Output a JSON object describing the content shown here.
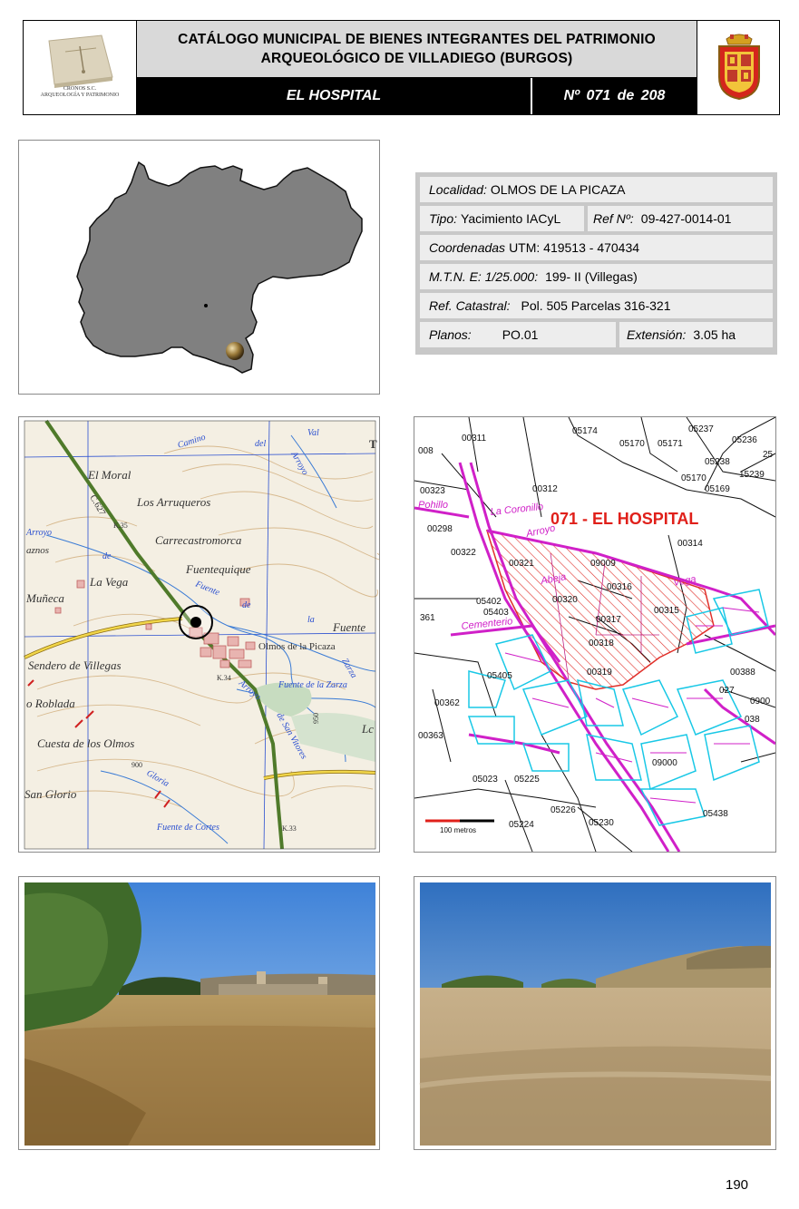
{
  "header": {
    "title": "CATÁLOGO MUNICIPAL DE BIENES INTEGRANTES DEL PATRIMONIO\nARQUEOLÓGICO DE VILLADIEGO (BURGOS)",
    "site_name": "EL HOSPITAL",
    "record_number": "Nº 071 de 208",
    "logo_caption_line1": "CRONOS S.C.",
    "logo_caption_line2": "ARQUEOLOGÍA Y PATRIMONIO"
  },
  "info": {
    "localidad_label": "Localidad:",
    "localidad_value": "OLMOS DE LA PICAZA",
    "tipo_label": "Tipo:",
    "tipo_value": "Yacimiento IACyL",
    "ref_label": "Ref  Nº:",
    "ref_value": "09-427-0014-01",
    "coord_label": "Coordenadas",
    "coord_value": "UTM: 419513 - 470434",
    "mtn_label": "M.T.N. E: 1/25.000:",
    "mtn_value": "199- II (Villegas)",
    "catastral_label": "Ref. Catastral:",
    "catastral_value": "Pol. 505 Parcelas 316-321",
    "planos_label": "Planos:",
    "planos_value": "PO.01",
    "extension_label": "Extensión:",
    "extension_value": "3.05  ha"
  },
  "topo_map": {
    "labels": {
      "el_moral": "El Moral",
      "c627": "C.627",
      "arrueros": "Los Arruqueros",
      "arroyo": "Arroyo",
      "aznos": "aznos",
      "carrecastromorca": "Carrecastromorca",
      "fuentequique": "Fuentequique",
      "la_vega": "La Vega",
      "muneca": "Muñeca",
      "fuente": "Fuente",
      "sendero": "Sendero de Villegas",
      "olmos": "Olmos de la Picaza",
      "roblada": "o Roblada",
      "cuesta": "Cuesta de los Olmos",
      "san_glorio": "San Glorio",
      "fuente_cortes": "Fuente de Cortes",
      "fuente_zarza": "Fuente de la Zarza",
      "camino": "Camino",
      "del": "del",
      "val": "Val",
      "k35": "K.35",
      "k34": "K.34",
      "k33": "K.33",
      "c900": "900",
      "c950": "950",
      "gloria": "Gloria",
      "san_vitores": "de San Vitores",
      "arroyo_de": "Arroyo",
      "de": "de",
      "la": "la",
      "zarza": "Zarza",
      "l": "L",
      "t": "T",
      "la_right": "Lc"
    }
  },
  "cadastral_map": {
    "title": "071 - EL HOSPITAL",
    "scale_label": "100 metros",
    "labels": {
      "p00311": "00311",
      "p05174": "05174",
      "p05170": "05170",
      "p05171": "05171",
      "p05237": "05237",
      "p05236": "05236",
      "p25": "25",
      "p05238": "05238",
      "p15239": "15239",
      "p05170b": "05170",
      "p05169": "05169",
      "p008": "008",
      "p00323": "00323",
      "p00312": "00312",
      "p00298": "00298",
      "p00314": "00314",
      "p00322": "00322",
      "p00321": "00321",
      "p00320": "00320",
      "p00316": "00316",
      "p00315": "00315",
      "p00317": "00317",
      "p00318": "00318",
      "p00319": "00319",
      "p361": "361",
      "p00388": "00388",
      "p00362": "00362",
      "p00363": "00363",
      "p05023": "05023",
      "p05225": "05225",
      "p05226": "05226",
      "p05224": "05224",
      "p05230": "05230",
      "p05438": "05438",
      "p09000": "09000",
      "p027": "027",
      "p0900": "0900",
      "p038": "038",
      "p09009": "09009",
      "p05402": "05402",
      "p05403": "05403",
      "p05405": "05405",
      "coronillo": "La Coronillo",
      "arroyo": "Arroyo",
      "vega": "Vega",
      "abeja": "Abeja",
      "cementerio": "Cementerio",
      "pohillo": "Pohillo"
    }
  },
  "page_number": "190"
}
